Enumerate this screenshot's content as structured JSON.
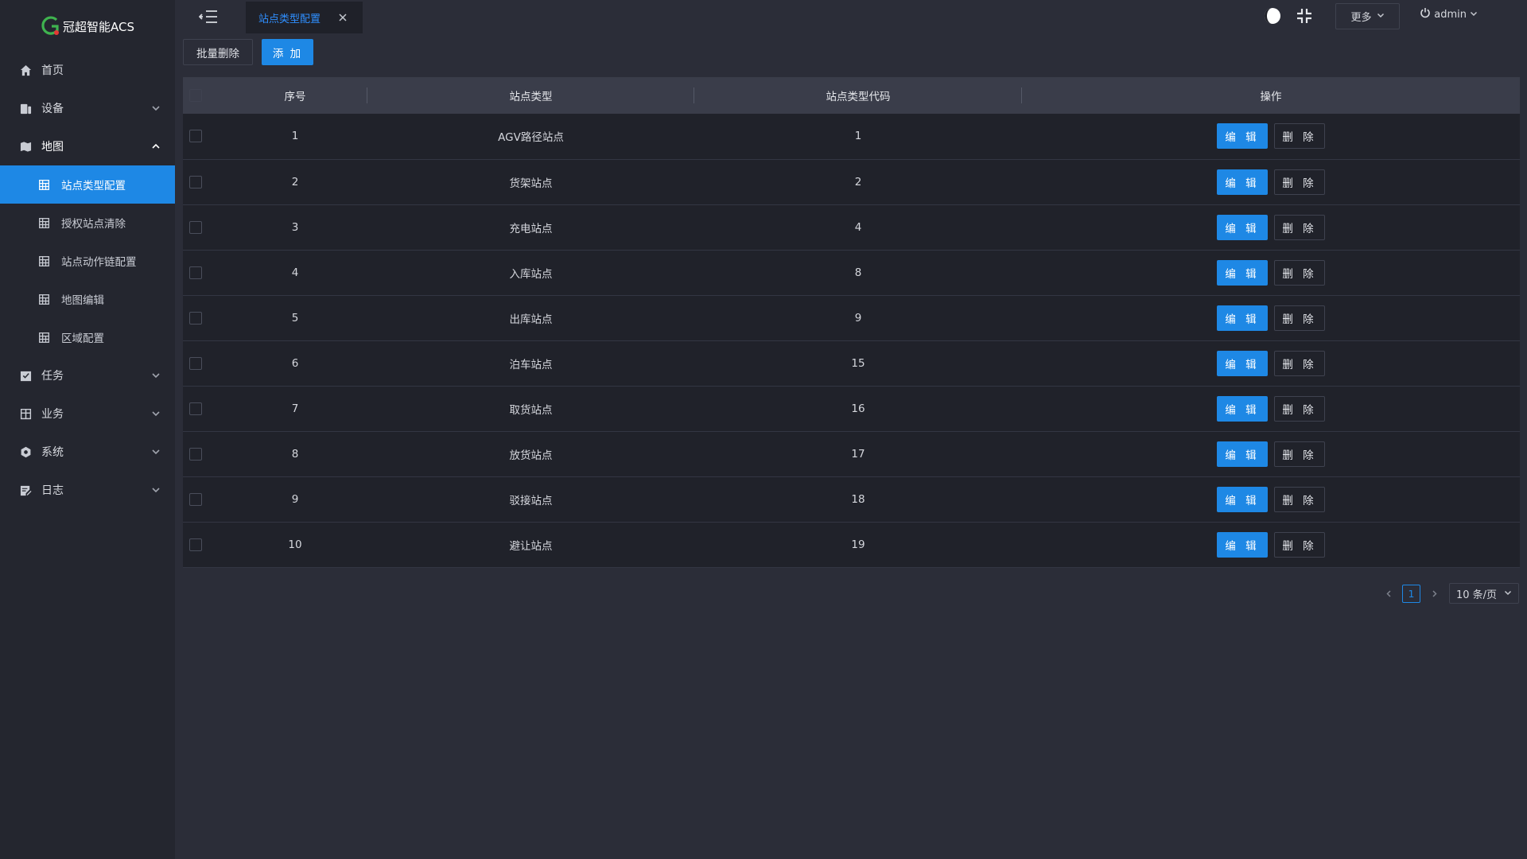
{
  "app": {
    "logo_text": "冠超智能ACS"
  },
  "sidebar": {
    "items": [
      {
        "label": "首页",
        "icon": "home-icon",
        "expandable": false
      },
      {
        "label": "设备",
        "icon": "device-icon",
        "expandable": true,
        "expanded": false
      },
      {
        "label": "地图",
        "icon": "map-icon",
        "expandable": true,
        "expanded": true,
        "children": [
          {
            "label": "站点类型配置",
            "active": true
          },
          {
            "label": "授权站点清除",
            "active": false
          },
          {
            "label": "站点动作链配置",
            "active": false
          },
          {
            "label": "地图编辑",
            "active": false
          },
          {
            "label": "区域配置",
            "active": false
          }
        ]
      },
      {
        "label": "任务",
        "icon": "task-icon",
        "expandable": true,
        "expanded": false
      },
      {
        "label": "业务",
        "icon": "business-icon",
        "expandable": true,
        "expanded": false
      },
      {
        "label": "系统",
        "icon": "system-icon",
        "expandable": true,
        "expanded": false
      },
      {
        "label": "日志",
        "icon": "log-icon",
        "expandable": true,
        "expanded": false
      }
    ]
  },
  "topbar": {
    "tab_label": "站点类型配置",
    "more_label": "更多",
    "user_label": "admin"
  },
  "toolbar": {
    "batch_delete_label": "批量删除",
    "add_label": "添 加"
  },
  "table": {
    "columns": [
      "序号",
      "站点类型",
      "站点类型代码",
      "操作"
    ],
    "edit_label": "编 辑",
    "delete_label": "删 除",
    "rows": [
      {
        "index": "1",
        "type": "AGV路径站点",
        "code": "1"
      },
      {
        "index": "2",
        "type": "货架站点",
        "code": "2"
      },
      {
        "index": "3",
        "type": "充电站点",
        "code": "4"
      },
      {
        "index": "4",
        "type": "入库站点",
        "code": "8"
      },
      {
        "index": "5",
        "type": "出库站点",
        "code": "9"
      },
      {
        "index": "6",
        "type": "泊车站点",
        "code": "15"
      },
      {
        "index": "7",
        "type": "取货站点",
        "code": "16"
      },
      {
        "index": "8",
        "type": "放货站点",
        "code": "17"
      },
      {
        "index": "9",
        "type": "驳接站点",
        "code": "18"
      },
      {
        "index": "10",
        "type": "避让站点",
        "code": "19"
      }
    ]
  },
  "pagination": {
    "current_page": "1",
    "page_size_label": "10 条/页"
  },
  "colors": {
    "accent": "#1e88e5",
    "background": "#2b2d38",
    "sidebar": "#24262f",
    "row": "#20222a",
    "header": "#3a3d4a"
  }
}
